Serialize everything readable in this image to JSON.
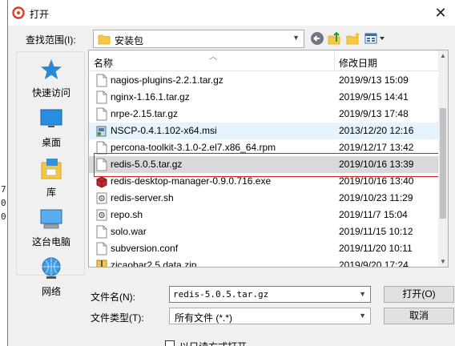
{
  "background_strip": {
    "chars": [
      "7",
      "0",
      "0"
    ]
  },
  "dialog": {
    "title": "打开",
    "close_label": "✕",
    "lookin_label": "查找范围(I):",
    "lookin_value": "安装包",
    "dropdown_arrow": "▼"
  },
  "places": [
    {
      "label": "快速访问",
      "icon": "star-icon"
    },
    {
      "label": "桌面",
      "icon": "desktop-icon"
    },
    {
      "label": "库",
      "icon": "library-icon"
    },
    {
      "label": "这台电脑",
      "icon": "computer-icon"
    },
    {
      "label": "网络",
      "icon": "network-icon"
    }
  ],
  "list": {
    "col_name": "名称",
    "col_date": "修改日期",
    "files": [
      {
        "name": "nagios-plugins-2.2.1.tar.gz",
        "date": "2019/9/13 15:09",
        "icon": "file-icon"
      },
      {
        "name": "nginx-1.16.1.tar.gz",
        "date": "2019/9/15 14:41",
        "icon": "file-icon"
      },
      {
        "name": "nrpe-2.15.tar.gz",
        "date": "2019/9/13 17:48",
        "icon": "file-icon"
      },
      {
        "name": "NSCP-0.4.1.102-x64.msi",
        "date": "2013/12/20 12:16",
        "icon": "msi-icon"
      },
      {
        "name": "percona-toolkit-3.1.0-2.el7.x86_64.rpm",
        "date": "2019/12/17 13:42",
        "icon": "file-icon"
      },
      {
        "name": "redis-5.0.5.tar.gz",
        "date": "2019/10/16 13:39",
        "icon": "file-icon"
      },
      {
        "name": "redis-desktop-manager-0.9.0.716.exe",
        "date": "2019/10/16 13:40",
        "icon": "exe-icon"
      },
      {
        "name": "redis-server.sh",
        "date": "2019/10/23 11:29",
        "icon": "script-icon"
      },
      {
        "name": "repo.sh",
        "date": "2019/11/7 15:04",
        "icon": "script-icon"
      },
      {
        "name": "solo.war",
        "date": "2019/11/15 10:12",
        "icon": "file-icon"
      },
      {
        "name": "subversion.conf",
        "date": "2019/11/20 10:11",
        "icon": "file-icon"
      },
      {
        "name": "zicaobar2.5 data.zip",
        "date": "2019/9/20 17:24",
        "icon": "zip-icon"
      }
    ]
  },
  "bottom": {
    "filename_label": "文件名(N):",
    "filename_value": "redis-5.0.5.tar.gz",
    "filetype_label": "文件类型(T):",
    "filetype_value": "所有文件 (*.*)",
    "open_label": "打开(O)",
    "cancel_label": "取消",
    "readonly_label": "以只读方式打开"
  },
  "colors": {
    "selection_border": "#cc2020",
    "hover_row": "#e5f3ff",
    "selected_row": "#d9d9d9"
  }
}
